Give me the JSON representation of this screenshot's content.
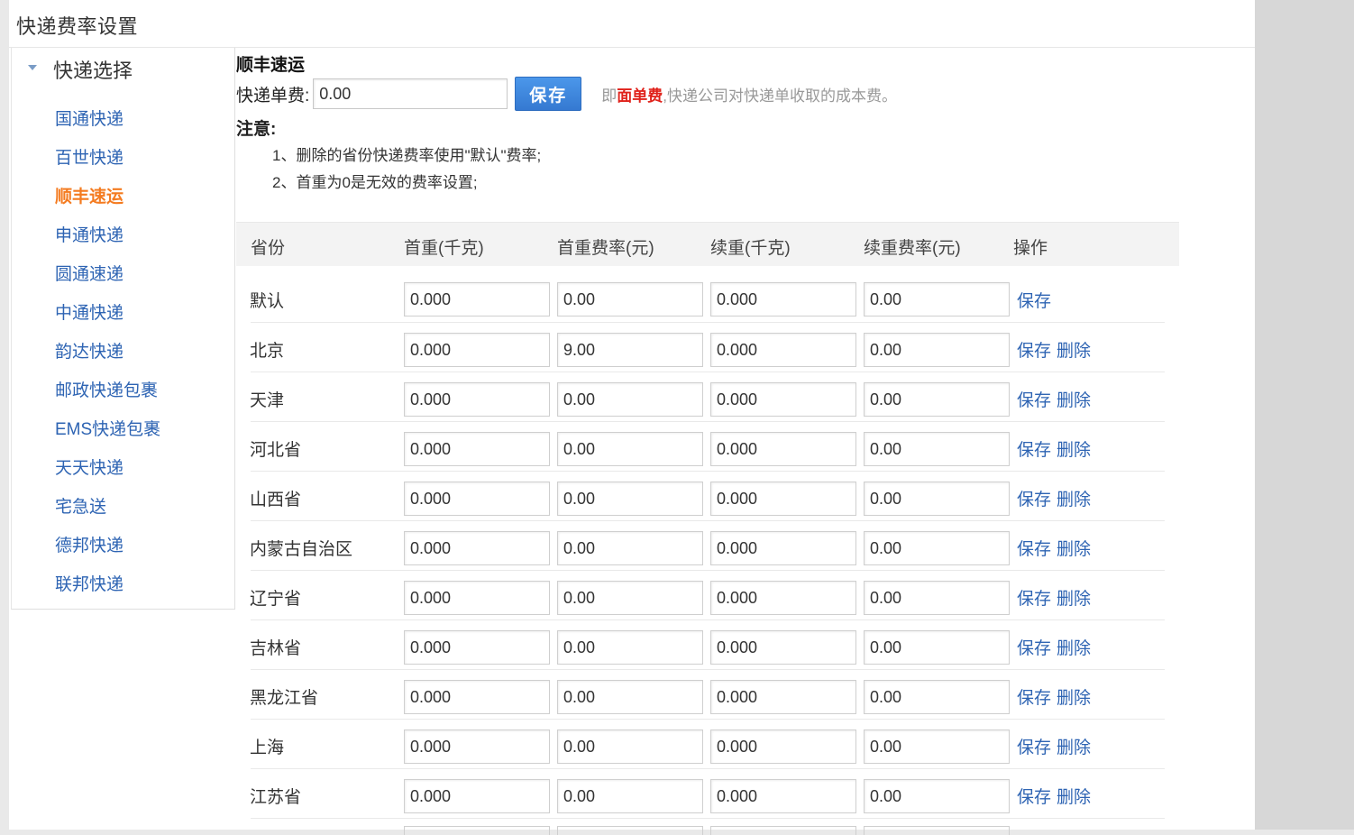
{
  "page_title": "快递费率设置",
  "sidebar": {
    "header": "快递选择",
    "items": [
      {
        "label": "国通快递",
        "active": false
      },
      {
        "label": "百世快递",
        "active": false
      },
      {
        "label": "顺丰速运",
        "active": true
      },
      {
        "label": "申通快递",
        "active": false
      },
      {
        "label": "圆通速递",
        "active": false
      },
      {
        "label": "中通快递",
        "active": false
      },
      {
        "label": "韵达快递",
        "active": false
      },
      {
        "label": "邮政快递包裹",
        "active": false
      },
      {
        "label": "EMS快递包裹",
        "active": false
      },
      {
        "label": "天天快递",
        "active": false
      },
      {
        "label": "宅急送",
        "active": false
      },
      {
        "label": "德邦快递",
        "active": false
      },
      {
        "label": "联邦快递",
        "active": false
      }
    ]
  },
  "main": {
    "carrier_name": "顺丰速运",
    "fee_label": "快递单费:",
    "fee_value": "0.00",
    "save_label": "保存",
    "hint_prefix": "即",
    "hint_em": "面单费",
    "hint_suffix": ",快递公司对快递单收取的成本费。",
    "notice_title": "注意:",
    "notices": [
      "1、删除的省份快递费率使用\"默认\"费率;",
      "2、首重为0是无效的费率设置;"
    ]
  },
  "table": {
    "headers": {
      "province": "省份",
      "first_weight": "首重(千克)",
      "first_rate": "首重费率(元)",
      "extra_weight": "续重(千克)",
      "extra_rate": "续重费率(元)",
      "ops": "操作"
    },
    "save_link": "保存",
    "delete_link": "删除",
    "rows": [
      {
        "province": "默认",
        "first_weight": "0.000",
        "first_rate": "0.00",
        "extra_weight": "0.000",
        "extra_rate": "0.00",
        "deletable": false
      },
      {
        "province": "北京",
        "first_weight": "0.000",
        "first_rate": "9.00",
        "extra_weight": "0.000",
        "extra_rate": "0.00",
        "deletable": true
      },
      {
        "province": "天津",
        "first_weight": "0.000",
        "first_rate": "0.00",
        "extra_weight": "0.000",
        "extra_rate": "0.00",
        "deletable": true
      },
      {
        "province": "河北省",
        "first_weight": "0.000",
        "first_rate": "0.00",
        "extra_weight": "0.000",
        "extra_rate": "0.00",
        "deletable": true
      },
      {
        "province": "山西省",
        "first_weight": "0.000",
        "first_rate": "0.00",
        "extra_weight": "0.000",
        "extra_rate": "0.00",
        "deletable": true
      },
      {
        "province": "内蒙古自治区",
        "first_weight": "0.000",
        "first_rate": "0.00",
        "extra_weight": "0.000",
        "extra_rate": "0.00",
        "deletable": true
      },
      {
        "province": "辽宁省",
        "first_weight": "0.000",
        "first_rate": "0.00",
        "extra_weight": "0.000",
        "extra_rate": "0.00",
        "deletable": true
      },
      {
        "province": "吉林省",
        "first_weight": "0.000",
        "first_rate": "0.00",
        "extra_weight": "0.000",
        "extra_rate": "0.00",
        "deletable": true
      },
      {
        "province": "黑龙江省",
        "first_weight": "0.000",
        "first_rate": "0.00",
        "extra_weight": "0.000",
        "extra_rate": "0.00",
        "deletable": true
      },
      {
        "province": "上海",
        "first_weight": "0.000",
        "first_rate": "0.00",
        "extra_weight": "0.000",
        "extra_rate": "0.00",
        "deletable": true
      },
      {
        "province": "江苏省",
        "first_weight": "0.000",
        "first_rate": "0.00",
        "extra_weight": "0.000",
        "extra_rate": "0.00",
        "deletable": true
      }
    ]
  },
  "colors": {
    "link": "#2e64b3",
    "active": "#f47b20",
    "emphasis": "#e0221b",
    "button": "#3b84de"
  }
}
